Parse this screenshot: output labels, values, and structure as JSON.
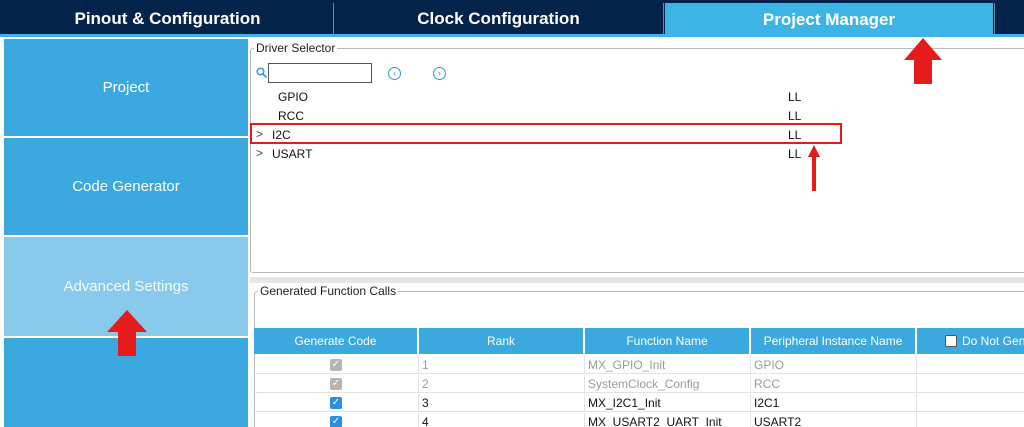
{
  "tabs": [
    {
      "label": "Pinout & Configuration"
    },
    {
      "label": "Clock Configuration"
    },
    {
      "label": "Project Manager"
    }
  ],
  "sidebar": {
    "items": [
      {
        "label": "Project"
      },
      {
        "label": "Code Generator"
      },
      {
        "label": "Advanced Settings"
      }
    ]
  },
  "driver_selector": {
    "legend": "Driver Selector",
    "search": {
      "value": "",
      "placeholder": ""
    },
    "prev_icon": "chevron-left-circle-icon",
    "next_icon": "chevron-right-circle-icon",
    "rows": [
      {
        "name": "GPIO",
        "value": "LL",
        "expandable": false
      },
      {
        "name": "RCC",
        "value": "LL",
        "expandable": false
      },
      {
        "name": "I2C",
        "value": "LL",
        "expandable": true
      },
      {
        "name": "USART",
        "value": "LL",
        "expandable": true
      }
    ],
    "chevron": ">"
  },
  "generated_calls": {
    "legend": "Generated Function Calls",
    "columns": [
      "Generate Code",
      "Rank",
      "Function Name",
      "Peripheral Instance Name",
      "Do Not Gen"
    ],
    "rows": [
      {
        "checked": true,
        "enabled": false,
        "rank": "1",
        "function": "MX_GPIO_Init",
        "instance": "GPIO"
      },
      {
        "checked": true,
        "enabled": false,
        "rank": "2",
        "function": "SystemClock_Config",
        "instance": "RCC"
      },
      {
        "checked": true,
        "enabled": true,
        "rank": "3",
        "function": "MX_I2C1_Init",
        "instance": "I2C1"
      },
      {
        "checked": true,
        "enabled": true,
        "rank": "4",
        "function": "MX_USART2_UART_Init",
        "instance": "USART2"
      }
    ]
  },
  "colors": {
    "navy": "#03234b",
    "accent": "#3cb4e6",
    "nav_active": "#88c9ec",
    "annotation_red": "#e41b1b"
  }
}
